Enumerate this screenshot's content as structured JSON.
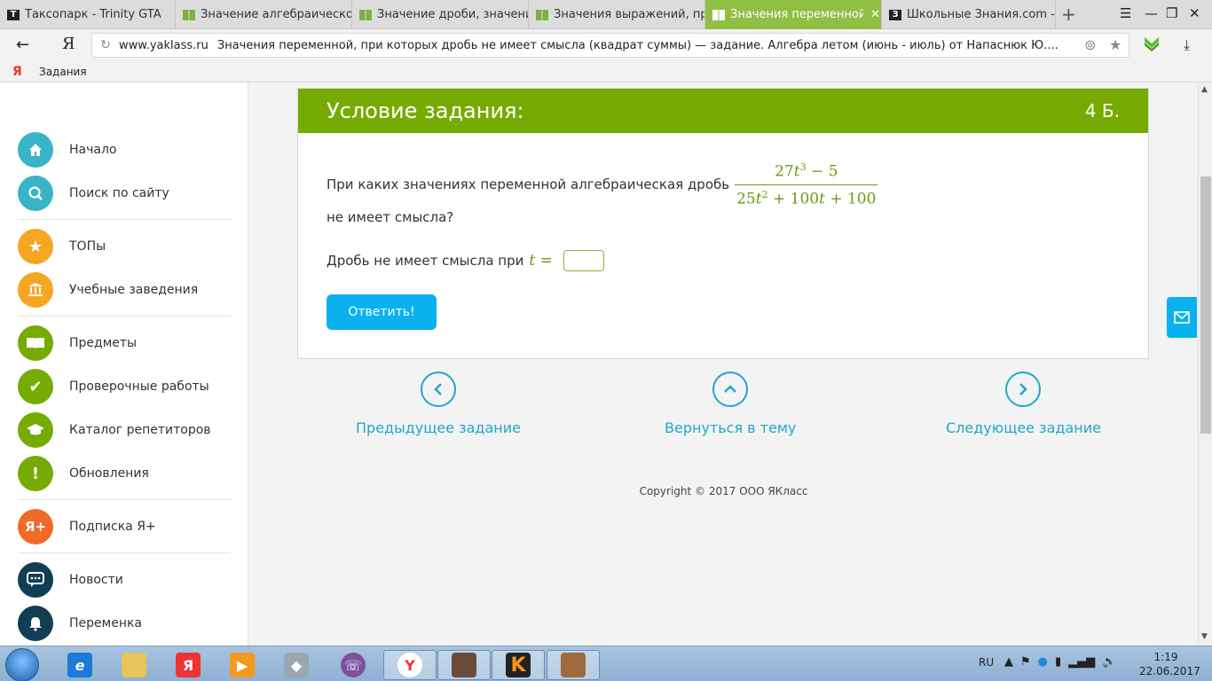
{
  "tabs": [
    {
      "label": "Таксопарк - Trinity GTA",
      "favicon": "T",
      "active": false
    },
    {
      "label": "Значение алгебраической",
      "favicon": "book",
      "active": false
    },
    {
      "label": "Значение дроби, значение",
      "favicon": "book",
      "active": false
    },
    {
      "label": "Значения выражений, при",
      "favicon": "book",
      "active": false
    },
    {
      "label": "Значения переменной, п",
      "favicon": "book",
      "active": true
    },
    {
      "label": "Школьные Знания.com - Ре",
      "favicon": "З",
      "active": false
    }
  ],
  "tab_close": "✕",
  "address": {
    "domain": "www.yaklass.ru",
    "title": "Значения переменной, при которых дробь не имеет смысла (квадрат суммы) — задание. Алгебра летом (июнь - июль) от Напаснюк Ю...."
  },
  "browser_logo": "Я",
  "bookmarks": [
    {
      "label": "Задания",
      "icon": "Я"
    }
  ],
  "sidebar": {
    "items": [
      {
        "label": "Начало",
        "icon": "home-icon",
        "color": "#3ab3c6",
        "glyph": "⌂"
      },
      {
        "label": "Поиск по сайту",
        "icon": "search-icon",
        "color": "#3ab3c6",
        "glyph": "⌕"
      },
      {
        "label": "ТОПы",
        "icon": "star-icon",
        "color": "#f5a623",
        "glyph": "★"
      },
      {
        "label": "Учебные заведения",
        "icon": "institution-icon",
        "color": "#f5a623",
        "glyph": "🏛"
      },
      {
        "label": "Предметы",
        "icon": "book-icon",
        "color": "#76ab04",
        "glyph": "📖"
      },
      {
        "label": "Проверочные работы",
        "icon": "check-icon",
        "color": "#76ab04",
        "glyph": "✔"
      },
      {
        "label": "Каталог репетиторов",
        "icon": "graduation-cap-icon",
        "color": "#76ab04",
        "glyph": "🎓"
      },
      {
        "label": "Обновления",
        "icon": "exclamation-icon",
        "color": "#76ab04",
        "glyph": "!"
      },
      {
        "label": "Подписка Я+",
        "icon": "ya-plus-icon",
        "color": "#f26a2a",
        "glyph": "Я+"
      },
      {
        "label": "Новости",
        "icon": "chat-icon",
        "color": "#123e54",
        "glyph": "💬"
      },
      {
        "label": "Переменка",
        "icon": "bell-icon",
        "color": "#123e54",
        "glyph": "🔔"
      }
    ]
  },
  "task": {
    "header_title": "Условие задания:",
    "score": "4 Б.",
    "question_text": "При каких значениях переменной алгебраическая дробь",
    "question_tail": "не имеет смысла?",
    "numerator": {
      "coef": "27",
      "var": "t",
      "exp": "3",
      "rest": " − 5"
    },
    "denominator": {
      "coef": "25",
      "var": "t",
      "exp": "2",
      "rest": " + 100",
      "var2": "t",
      "rest2": " + 100"
    },
    "answer_prompt": "Дробь не имеет смысла при",
    "answer_var": "t =",
    "answer_value": "",
    "submit_label": "Ответить!"
  },
  "nav": {
    "prev_label": "Предыдущее задание",
    "back_label": "Вернуться в тему",
    "next_label": "Следующее задание"
  },
  "copyright": "Copyright © 2017 ООО ЯКласс",
  "taskbar": {
    "lang": "RU",
    "time": "1:19",
    "date": "22.06.2017"
  },
  "colors": {
    "accent_green": "#76ab04",
    "button_blue": "#0ab1ef",
    "link_teal": "#1ea8c8",
    "active_tab": "#8fc044"
  }
}
